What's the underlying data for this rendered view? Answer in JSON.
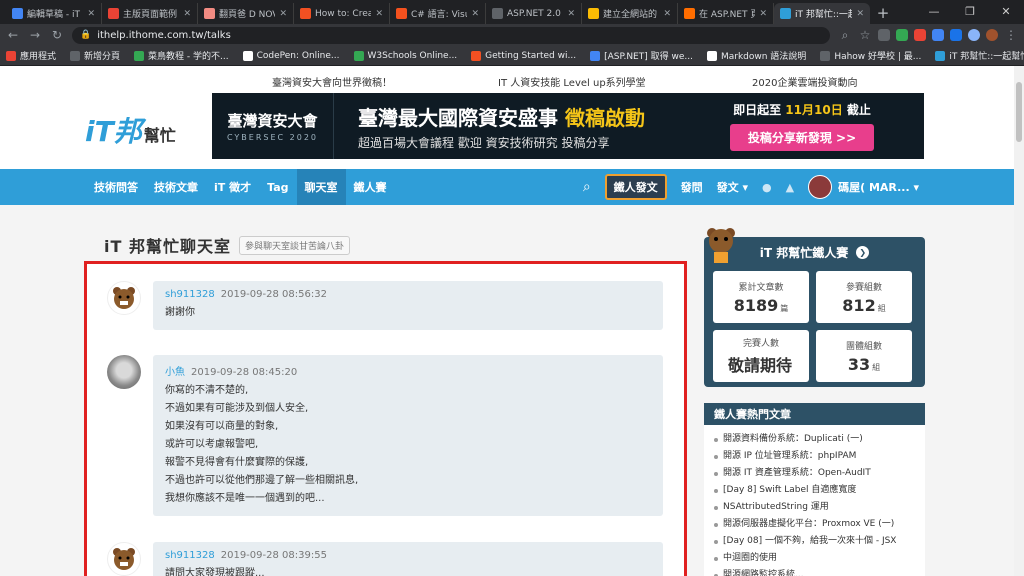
{
  "browser": {
    "tabs": [
      {
        "label": "編輯草稿 - iT 邦",
        "color": "#4285f4"
      },
      {
        "label": "主版頁面範例",
        "color": "#ea4335"
      },
      {
        "label": "翻頁爸 D NOV",
        "color": "#f28b82"
      },
      {
        "label": "How to: Creat",
        "color": "#f25022"
      },
      {
        "label": "C# 語言: Visua",
        "color": "#f4511e"
      },
      {
        "label": "ASP.NET 2.0",
        "color": "#5f6368"
      },
      {
        "label": "建立全網站的",
        "color": "#fbbc04"
      },
      {
        "label": "在 ASP.NET 頁",
        "color": "#ff6d00"
      },
      {
        "label": "iT 邦幫忙::一起",
        "color": "#2f9ed8"
      }
    ],
    "new_tab": "+",
    "url": "ithelp.ithome.com.tw/talks",
    "bookmarks": [
      {
        "label": "應用程式",
        "color": "#ea4335"
      },
      {
        "label": "新增分頁",
        "color": "#5f6368"
      },
      {
        "label": "菜鳥教程 - 学的不...",
        "color": "#34a853"
      },
      {
        "label": "CodePen: Online...",
        "color": "#fff"
      },
      {
        "label": "W3Schools Online...",
        "color": "#34a853"
      },
      {
        "label": "Getting Started wi...",
        "color": "#f25022"
      },
      {
        "label": "[ASP.NET] 取得 we...",
        "color": "#4285f4"
      },
      {
        "label": "Markdown 語法說明",
        "color": "#fff"
      },
      {
        "label": "Hahow 好學校 | 最...",
        "color": "#5f6368"
      },
      {
        "label": "iT 邦幫忙::一起幫忙...",
        "color": "#2f9ed8"
      }
    ]
  },
  "header": {
    "promos": [
      "臺灣資安大會向世界徵稿！",
      "IT 人資安技能 Level up系列學堂",
      "2020企業雲端投資動向"
    ],
    "logo_main": "iT邦",
    "logo_sub": "幫忙",
    "banner": {
      "left_title": "臺灣資安大會",
      "left_sub": "CYBERSEC 2020",
      "headline_a": "臺灣最大國際資安盛事 ",
      "headline_b": "徵稿啟動",
      "subline": "超過百場大會議程 歡迎 資安技術研究 投稿分享",
      "deadline_a": "即日起至 ",
      "deadline_b": "11月10日",
      "deadline_c": " 截止",
      "cta": "投稿分享新發現 >>"
    }
  },
  "nav": {
    "items": [
      "技術問答",
      "技術文章",
      "iT 徵才",
      "Tag",
      "聊天室",
      "鐵人賽"
    ],
    "active_index": 4,
    "post_button": "鐵人發文",
    "ask": "發問",
    "post_menu": "發文 ▾",
    "username": "碼屋( MAR... ▾"
  },
  "page": {
    "title": "iT 邦幫忙聊天室",
    "subtitle": "參與聊天室談甘苦論八卦"
  },
  "chat": [
    {
      "author": "sh911328",
      "time": "2019-09-28 08:56:32",
      "lines": [
        "謝謝你"
      ],
      "avatar": "bear"
    },
    {
      "author": "小魚",
      "time": "2019-09-28 08:45:20",
      "lines": [
        "你寫的不清不楚的,",
        "不過如果有可能涉及到個人安全,",
        "如果沒有可以商量的對象,",
        "或許可以考慮報警吧,",
        "報警不見得會有什麼實際的保護,",
        "不過也許可以從他們那邊了解一些相關訊息,",
        "我想你應該不是唯一一個遇到的吧..."
      ],
      "avatar": "koala"
    },
    {
      "author": "sh911328",
      "time": "2019-09-28 08:39:55",
      "lines": [
        "請問大家發現被跟蹤..."
      ],
      "avatar": "bear"
    }
  ],
  "sidebar": {
    "ironman_title": "iT 邦幫忙鐵人賽",
    "stats": [
      {
        "label": "累計文章數",
        "value": "8189",
        "unit": "篇"
      },
      {
        "label": "參賽組數",
        "value": "812",
        "unit": "組"
      },
      {
        "label": "完賽人數",
        "value": "敬請期待",
        "unit": ""
      },
      {
        "label": "團體組數",
        "value": "33",
        "unit": "組"
      }
    ],
    "hot_title": "鐵人賽熱門文章",
    "hot_articles": [
      "開源資料備份系統：Duplicati (一)",
      "開源 IP 位址管理系統：phpIPAM",
      "開源 IT 資產管理系統：Open-AudIT",
      "[Day 8] Swift Label 自適應寬度",
      "NSAttributedString 運用",
      "開源伺服器虛擬化平台：Proxmox VE (一)",
      "[Day 08] 一個不夠，給我一次來十個 - JSX",
      "中迴圈的使用",
      "開源網路監控系統..."
    ]
  },
  "colors": {
    "brand": "#2f9ed8",
    "highlight": "#e02020",
    "sidebar_dark": "#2d5166"
  }
}
